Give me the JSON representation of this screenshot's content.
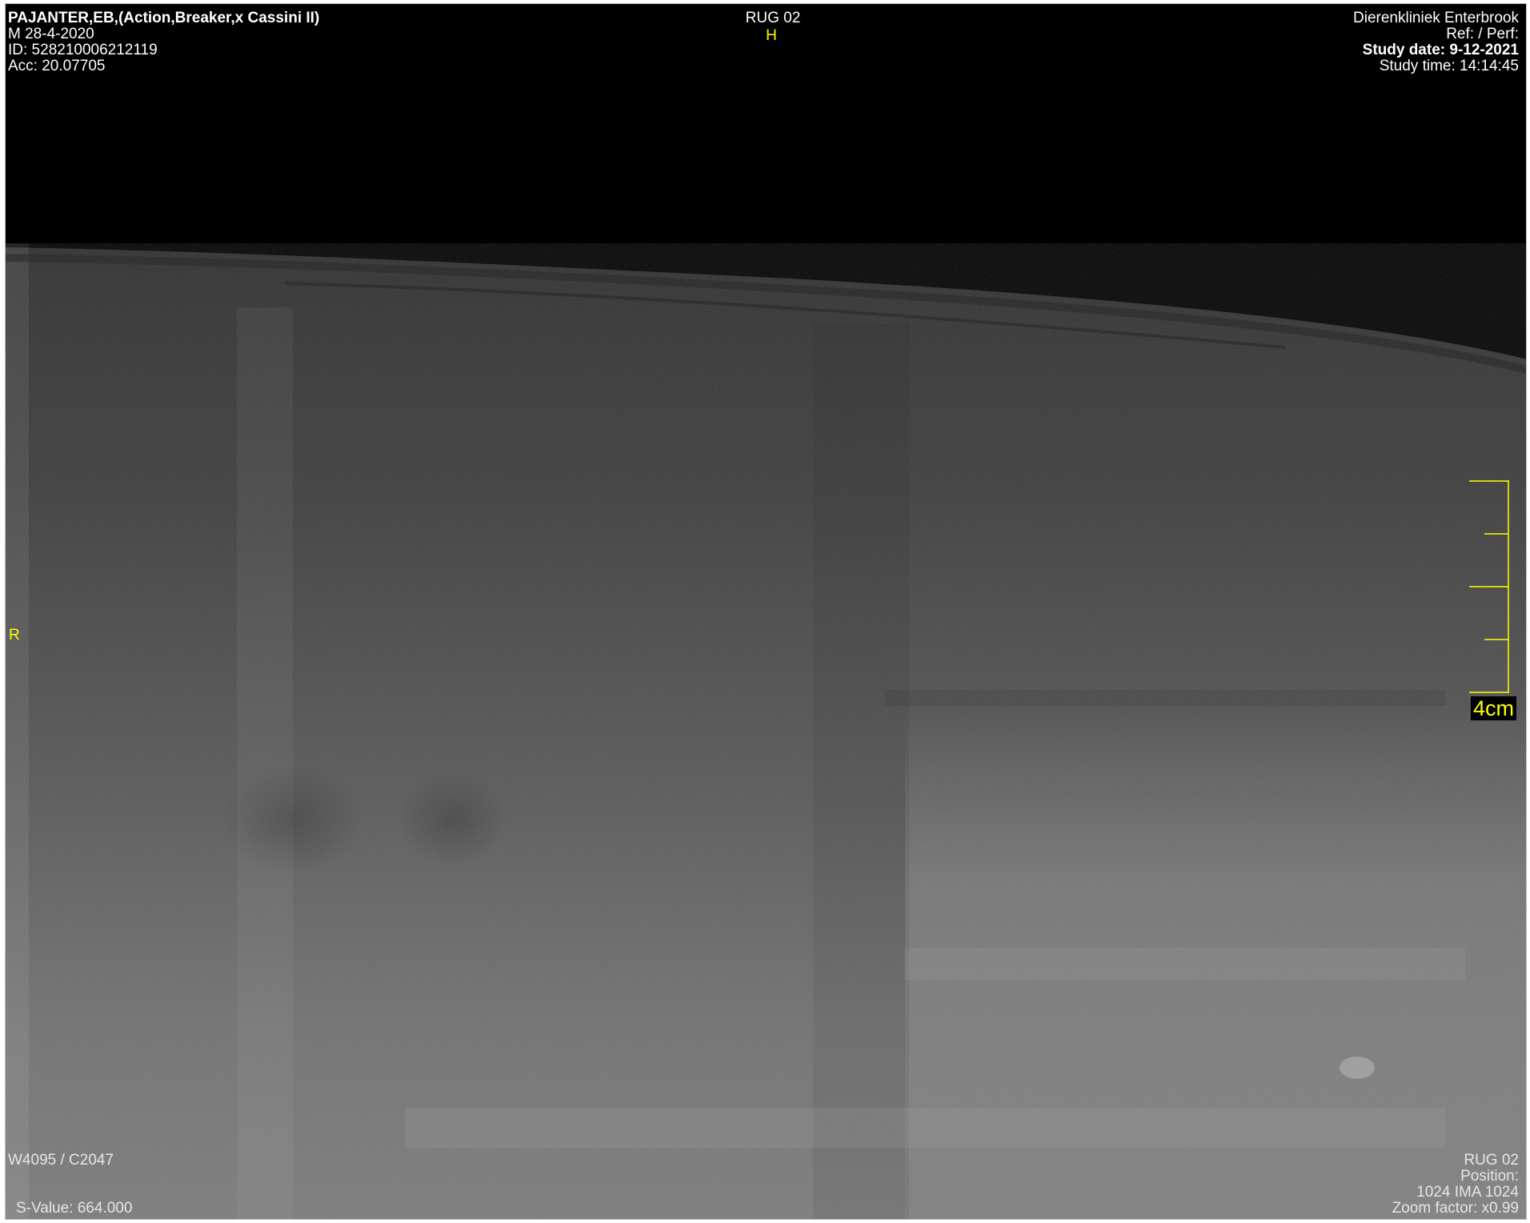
{
  "patient": {
    "name": "PAJANTER,EB,(Action,Breaker,x Cassini II)",
    "sex_dob": "M  28-4-2020",
    "id": "ID: 528210006212119",
    "accession": "Acc: 20.07705"
  },
  "series": {
    "title": "RUG 02",
    "orientation_top": "H",
    "orientation_left": "R"
  },
  "institution": {
    "name": "Dierenkliniek Enterbrook",
    "ref_perf": "Ref:  / Perf:",
    "study_date": "Study date: 9-12-2021",
    "study_time": "Study time: 14:14:45"
  },
  "window": {
    "level": "W4095 / C2047",
    "s_value": "S-Value: 664.000"
  },
  "image_info": {
    "series_name": "RUG 02",
    "position": "Position:",
    "ima": "1024 IMA 1024",
    "zoom": "Zoom factor: x0.99"
  },
  "ruler": {
    "label": "4cm",
    "color": "#ffff00"
  },
  "colors": {
    "overlay_text": "#ffffff",
    "annotation": "#ffff00",
    "background": "#000000"
  }
}
